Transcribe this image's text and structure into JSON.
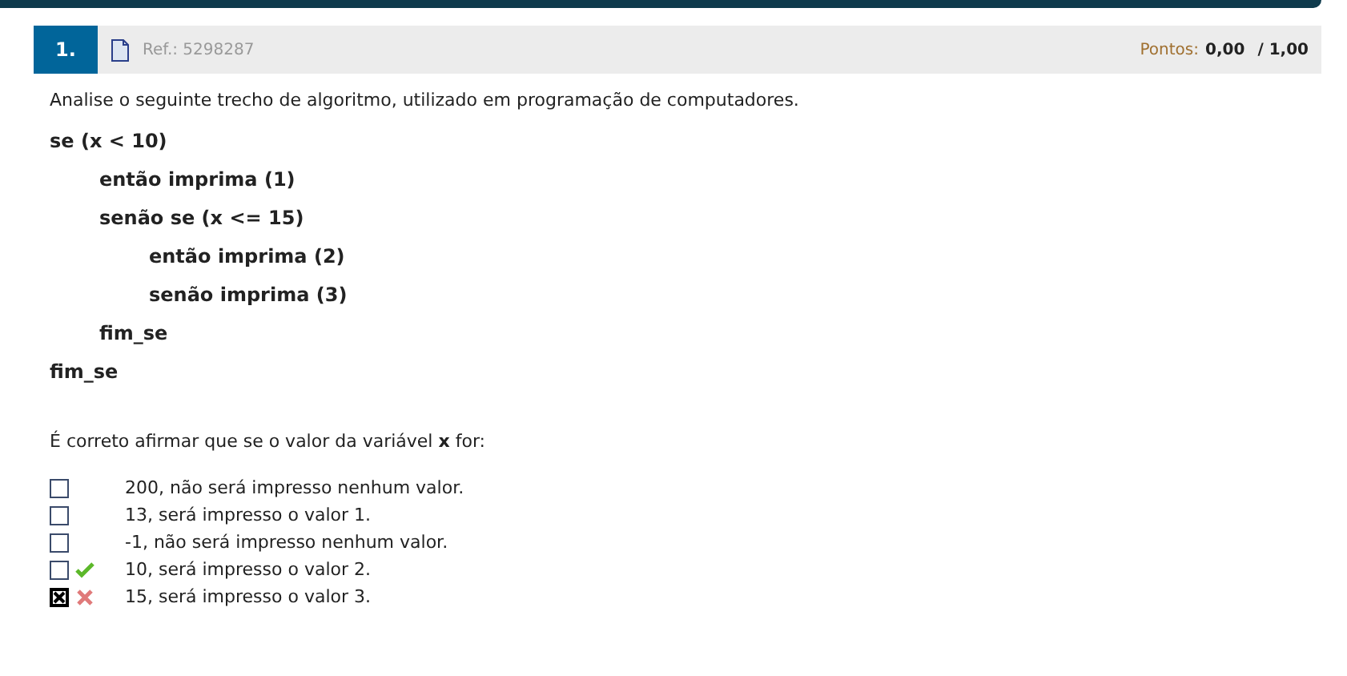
{
  "question": {
    "number": "1.",
    "ref": "Ref.: 5298287",
    "points_label": "Pontos:",
    "points": "0,00",
    "max_points": "/ 1,00"
  },
  "intro": "Analise o seguinte trecho de algoritmo, utilizado em programação de computadores.",
  "code": [
    {
      "text": "se (x < 10)",
      "children": [
        {
          "text": "então imprima (1)"
        },
        {
          "text": "senão se (x <= 15)",
          "children": [
            {
              "text": "então imprima (2)"
            },
            {
              "text": "senão imprima (3)"
            }
          ]
        },
        {
          "text": "fim_se"
        }
      ]
    },
    {
      "text": "fim_se"
    }
  ],
  "prompt": "É correto afirmar que se o valor da variável **x** for:",
  "options": [
    {
      "text": "200, não será impresso nenhum valor.",
      "checked": false,
      "marked_correct": false,
      "marked_wrong": false
    },
    {
      "text": "13, será impresso o valor 1.",
      "checked": false,
      "marked_correct": false,
      "marked_wrong": false
    },
    {
      "text": "-1, não será impresso nenhum valor.",
      "checked": false,
      "marked_correct": false,
      "marked_wrong": false
    },
    {
      "text": "10, será impresso o valor 2.",
      "checked": false,
      "marked_correct": true,
      "marked_wrong": false
    },
    {
      "text": "15, será impresso o valor 3.",
      "checked": true,
      "marked_correct": false,
      "marked_wrong": true
    }
  ]
}
